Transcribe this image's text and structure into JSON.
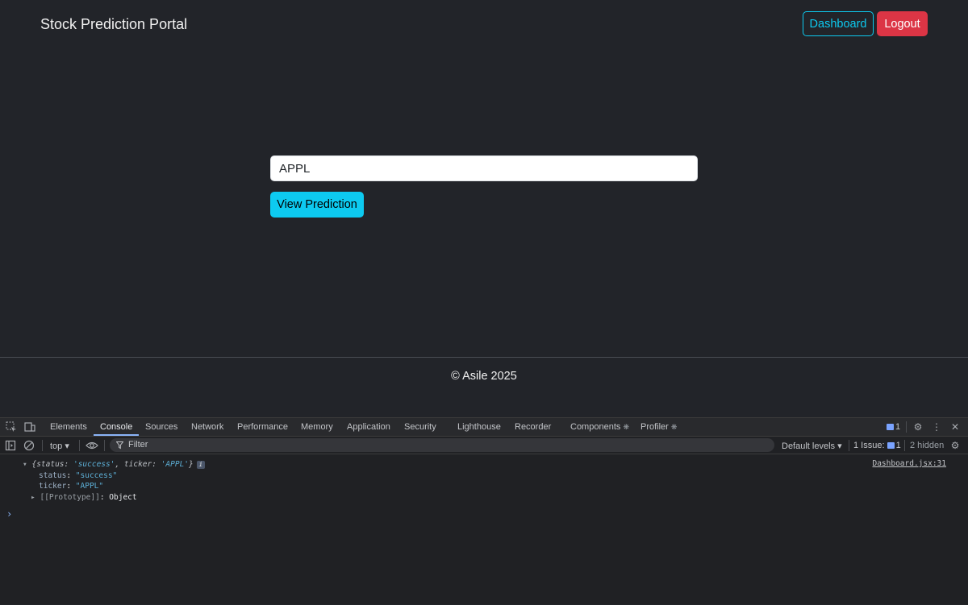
{
  "navbar": {
    "brand": "Stock Prediction Portal",
    "dashboard_label": "Dashboard",
    "logout_label": "Logout"
  },
  "main": {
    "ticker_value": "APPL",
    "submit_label": "View Prediction"
  },
  "footer": {
    "text": "© Asile 2025"
  },
  "devtools": {
    "tabs": [
      "Elements",
      "Console",
      "Sources",
      "Network",
      "Performance",
      "Memory",
      "Application",
      "Security",
      "Lighthouse",
      "Recorder",
      "Components",
      "Profiler"
    ],
    "active_tab": "Console",
    "message_count": "1",
    "context": "top",
    "filter_placeholder": "Filter",
    "levels_label": "Default levels",
    "issues_label": "1 Issue:",
    "issues_count": "1",
    "hidden_label": "2 hidden",
    "log": {
      "summary_open": "{",
      "summary_key1": "status",
      "summary_val1": "'success'",
      "summary_key2": "ticker",
      "summary_val2": "'APPL'",
      "summary_close": "}",
      "status_key": "status",
      "status_val": "\"success\"",
      "ticker_key": "ticker",
      "ticker_val": "\"APPL\"",
      "proto_key": "[[Prototype]]",
      "proto_val": "Object",
      "source": "Dashboard.jsx:31"
    },
    "prompt_glyph": "›"
  }
}
